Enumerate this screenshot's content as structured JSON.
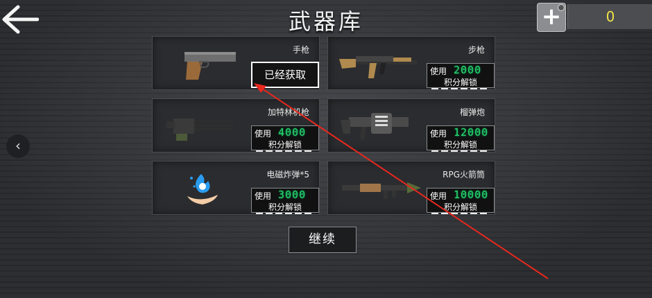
{
  "header": {
    "title": "武器库",
    "back_icon": "back-arrow-icon",
    "add_icon": "plus-icon",
    "points": "0"
  },
  "nav": {
    "prev_icon": "chevron-left-icon"
  },
  "weapons": [
    {
      "name": "手枪",
      "owned_label": "已经获取",
      "icon": "pistol-icon"
    },
    {
      "name": "步枪",
      "use_label": "使用",
      "cost": "2000",
      "unlock_label": "积分解锁",
      "icon": "rifle-icon"
    },
    {
      "name": "加特林机枪",
      "use_label": "使用",
      "cost": "4000",
      "unlock_label": "积分解锁",
      "icon": "gatling-gun-icon"
    },
    {
      "name": "榴弹炮",
      "use_label": "使用",
      "cost": "12000",
      "unlock_label": "积分解锁",
      "icon": "grenade-launcher-icon"
    },
    {
      "name": "电磁炸弹*5",
      "use_label": "使用",
      "cost": "3000",
      "unlock_label": "积分解锁",
      "icon": "emp-bomb-icon"
    },
    {
      "name": "RPG火箭筒",
      "use_label": "使用",
      "cost": "10000",
      "unlock_label": "积分解锁",
      "icon": "rpg-launcher-icon"
    }
  ],
  "footer": {
    "continue_label": "继续"
  },
  "colors": {
    "cost_green": "#2bd96b",
    "points_yellow": "#f2e24a",
    "annotation_red": "#e8281e"
  }
}
